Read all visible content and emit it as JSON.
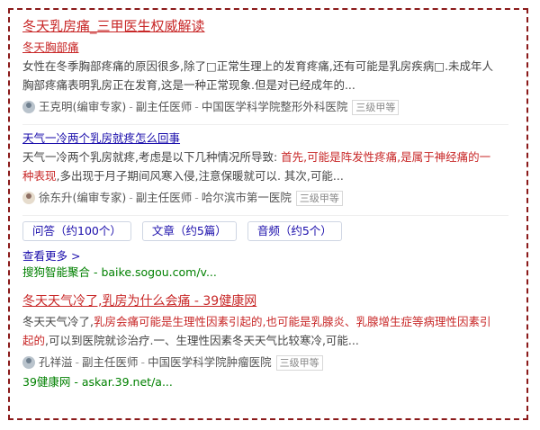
{
  "results": [
    {
      "title": "冬天乳房痛_三甲医生权威解读",
      "subtitle": "冬天胸部痛",
      "snippet_lines": [
        "女性在冬季胸部疼痛的原因很多,除了□正常生理上的发育疼痛,还有可能是乳房疾病□.未成年人",
        "胸部疼痛表明乳房正在发育,这是一种正常现象.但是对已经成年的..."
      ],
      "author": "王克明(编审专家)",
      "role": "副主任医师",
      "hospital": "中国医学科学院整形外科医院",
      "badge": "三级甲等"
    },
    {
      "title": "天气一冷两个乳房就疼怎么回事",
      "snippet_line1_plain": "天气一冷两个乳房就疼,考虑是以下几种情况所导致: ",
      "snippet_line1_hl": "首先,可能是阵发性疼痛,是属于神经痛的一",
      "snippet_line2_hl": "种表现",
      "snippet_line2_plain": ",多出现于月子期间风寒入侵,注意保暖就可以. 其次,可能...",
      "author": "徐东升(编审专家)",
      "role": "副主任医师",
      "hospital": "哈尔滨市第一医院",
      "badge": "三级甲等"
    }
  ],
  "tabs": [
    "问答（约100个）",
    "文章（约5篇）",
    "音频（约5个）"
  ],
  "more_label": "查看更多 >",
  "source1": "搜狗智能聚合 - baike.sogou.com/v...",
  "result3": {
    "title": "冬天天气冷了,乳房为什么会痛 - 39健康网",
    "line1_plain": "冬天天气冷了,",
    "line1_hl": "乳房会痛可能是生理性因素引起的,也可能是乳腺炎、乳腺增生症等病理性因素引",
    "line2_hl": "起的",
    "line2_plain": ",可以到医院就诊治疗.一、生理性因素冬天天气比较寒冷,可能...",
    "author": "孔祥溢",
    "role": "副主任医师",
    "hospital": "中国医学科学院肿瘤医院",
    "badge": "三级甲等",
    "source": "39健康网 - askar.39.net/a..."
  },
  "sep": "-"
}
